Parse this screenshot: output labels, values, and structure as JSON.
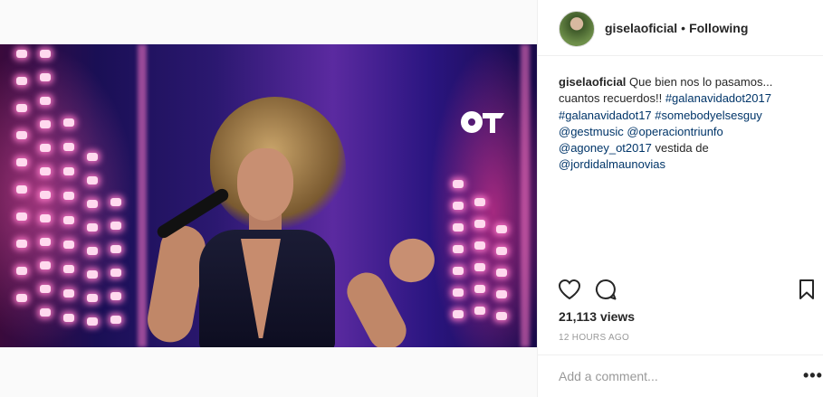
{
  "post": {
    "username": "giselaoficial",
    "separator": "•",
    "follow_state": "Following",
    "caption": {
      "username": "giselaoficial",
      "text": "Que bien nos lo pasamos... cuantos recuerdos!!",
      "tags": [
        "#galanavidadot2017",
        "#galanavidadot17",
        "#somebodyelsesguy",
        "@gestmusic",
        "@operaciontriunfo",
        "@agoney_ot2017"
      ],
      "trailing_text": "vestida de",
      "last_tag": "@jordidalmaunovias"
    },
    "views": "21,113 views",
    "timestamp": "12 HOURS AGO",
    "comment_placeholder": "Add a comment...",
    "more_label": "•••"
  },
  "icons": {
    "like": "heart-icon",
    "comment": "comment-bubble-icon",
    "save": "bookmark-icon",
    "more": "more-options-icon"
  },
  "colors": {
    "text": "#262626",
    "link": "#003569",
    "muted": "#999999",
    "border": "#efefef"
  }
}
